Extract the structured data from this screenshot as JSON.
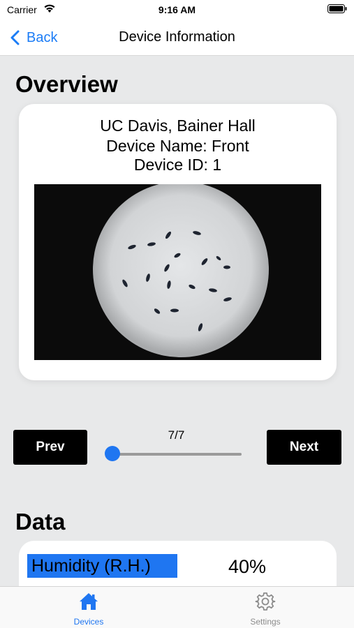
{
  "status_bar": {
    "carrier": "Carrier",
    "time": "9:16 AM"
  },
  "nav": {
    "back_label": "Back",
    "title": "Device Information"
  },
  "overview": {
    "heading": "Overview",
    "location": "UC Davis, Bainer Hall",
    "device_name": "Device Name: Front",
    "device_id": "Device ID: 1"
  },
  "controls": {
    "prev_label": "Prev",
    "next_label": "Next",
    "counter": "7/7",
    "slider_value": 0
  },
  "data_section": {
    "heading": "Data",
    "humidity_label": "Humidity (R.H.)",
    "humidity_value": "40%"
  },
  "tab_bar": {
    "tabs": [
      {
        "label": "Devices",
        "icon": "house-icon",
        "active": true
      },
      {
        "label": "Settings",
        "icon": "gear-icon",
        "active": false
      }
    ]
  },
  "colors": {
    "accent": "#1f76f1",
    "background": "#e8e9ea"
  }
}
